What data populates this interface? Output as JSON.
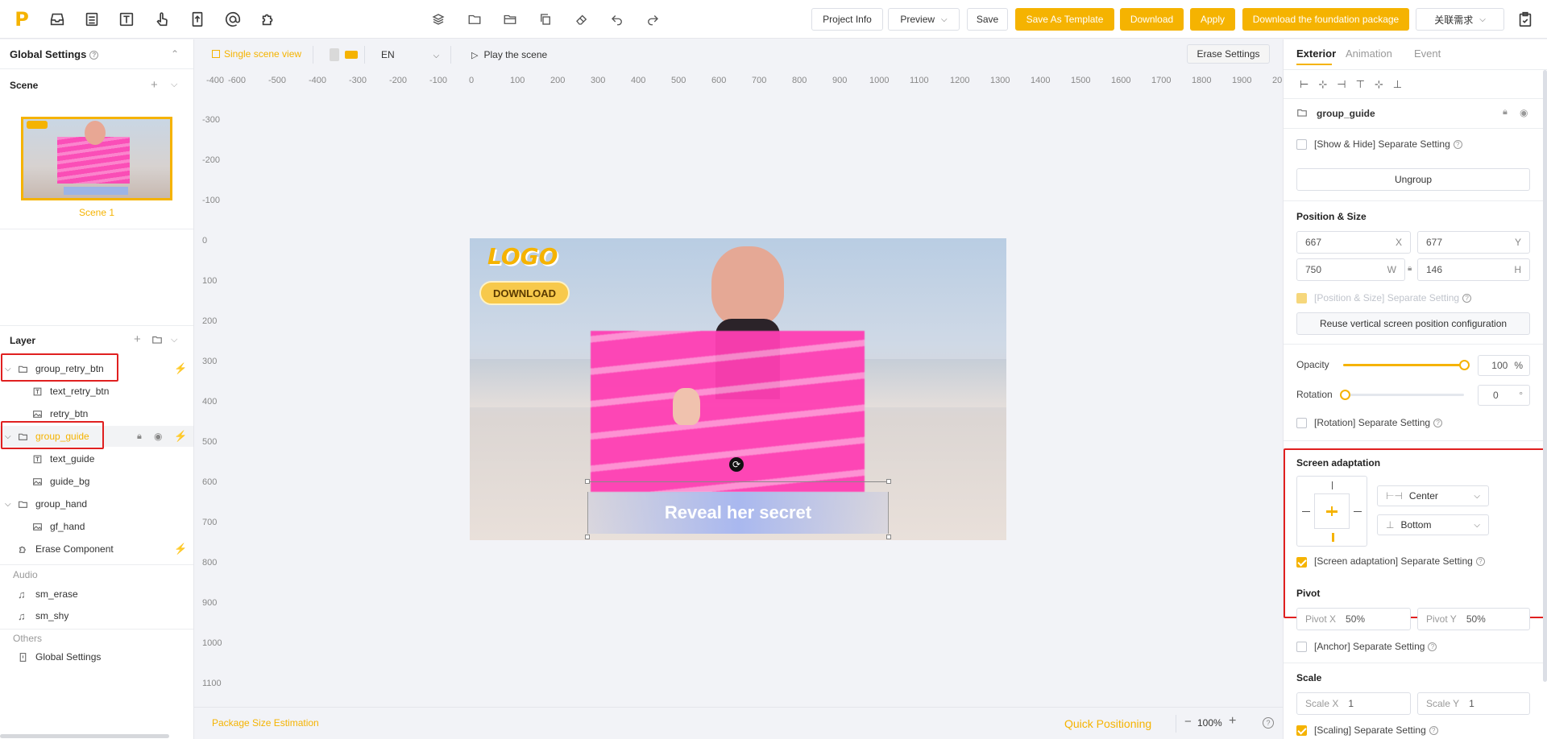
{
  "toolbar": {
    "logo": "P",
    "left_icons": [
      "inbox-icon",
      "table-icon",
      "text-icon",
      "hand-pointer-icon",
      "file-upload-icon",
      "at-icon",
      "puzzle-icon"
    ],
    "mid_icons": [
      "layers-icon",
      "folder-icon",
      "folder-open-icon",
      "copy-icon",
      "eraser-icon",
      "undo-icon",
      "redo-icon"
    ],
    "project_info": "Project Info",
    "preview": "Preview",
    "save": "Save",
    "save_as_template": "Save As Template",
    "download": "Download",
    "apply": "Apply",
    "download_foundation": "Download the foundation package",
    "linked_demand": "关联需求"
  },
  "left": {
    "global_settings": "Global Settings",
    "scene_header": "Scene",
    "scene_name": "Scene 1",
    "layer_header": "Layer",
    "layers": [
      {
        "name": "group_retry_btn",
        "type": "folder",
        "level": 0
      },
      {
        "name": "text_retry_btn",
        "type": "text",
        "level": 1
      },
      {
        "name": "retry_btn",
        "type": "image",
        "level": 1
      },
      {
        "name": "group_guide",
        "type": "folder",
        "level": 0
      },
      {
        "name": "text_guide",
        "type": "text",
        "level": 1
      },
      {
        "name": "guide_bg",
        "type": "image",
        "level": 1
      },
      {
        "name": "group_hand",
        "type": "folder",
        "level": 0
      },
      {
        "name": "gf_hand",
        "type": "image",
        "level": 1
      },
      {
        "name": "Erase Component",
        "type": "component",
        "level": 0
      }
    ],
    "audio_header": "Audio",
    "audio": [
      "sm_erase",
      "sm_shy"
    ],
    "others_header": "Others",
    "others": [
      "Global Settings"
    ]
  },
  "canvas": {
    "single_scene_view": "Single scene view",
    "language": "EN",
    "play": "Play the scene",
    "erase_settings": "Erase Settings",
    "ruler_x": [
      "-600",
      "-500",
      "-400",
      "-300",
      "-200",
      "-100",
      "0",
      "100",
      "200",
      "300",
      "400",
      "500",
      "600",
      "700",
      "800",
      "900",
      "1000",
      "1100",
      "1200",
      "1300",
      "1400",
      "1500",
      "1600",
      "1700",
      "1800",
      "1900",
      "20"
    ],
    "ruler_x_first": "-400",
    "ruler_y": [
      "-300",
      "-200",
      "-100",
      "0",
      "100",
      "200",
      "300",
      "400",
      "500",
      "600",
      "700",
      "800",
      "900",
      "1000",
      "1100"
    ],
    "logo_text": "LOGO",
    "download_btn": "DOWNLOAD",
    "guide_text": "Reveal her secret",
    "package_size": "Package Size Estimation",
    "quick_positioning": "Quick Positioning",
    "zoom": "100%",
    "minus": "−",
    "plus": "+"
  },
  "right": {
    "tabs": [
      "Exterior",
      "Animation",
      "Event"
    ],
    "active_tab": "Exterior",
    "object_name": "group_guide",
    "show_hide": "[Show & Hide] Separate Setting",
    "ungroup": "Ungroup",
    "pos_size_header": "Position & Size",
    "x": "667",
    "x_lbl": "X",
    "y": "677",
    "y_lbl": "Y",
    "w": "750",
    "w_lbl": "W",
    "h": "146",
    "h_lbl": "H",
    "pos_size_sep": "[Position & Size] Separate Setting",
    "reuse_vertical": "Reuse vertical screen position configuration",
    "opacity_lbl": "Opacity",
    "opacity": "100",
    "opacity_unit": "%",
    "opacity_level": 1.0,
    "rotation_lbl": "Rotation",
    "rotation": "0",
    "rotation_unit": "°",
    "rotation_sep": "[Rotation] Separate Setting",
    "screen_adapt_header": "Screen adaptation",
    "h_align": "Center",
    "v_align": "Bottom",
    "screen_adapt_sep": "[Screen adaptation] Separate Setting",
    "pivot_header": "Pivot",
    "pivot_x_lbl": "Pivot X",
    "pivot_x": "50%",
    "pivot_y_lbl": "Pivot Y",
    "pivot_y": "50%",
    "anchor_sep": "[Anchor] Separate Setting",
    "scale_header": "Scale",
    "scale_x_lbl": "Scale X",
    "scale_x": "1",
    "scale_y_lbl": "Scale Y",
    "scale_y": "1",
    "scaling_sep": "[Scaling] Separate Setting"
  },
  "colors": {
    "accent": "#f5b301",
    "highlight": "#e02020",
    "pink": "#ff3fb4"
  }
}
